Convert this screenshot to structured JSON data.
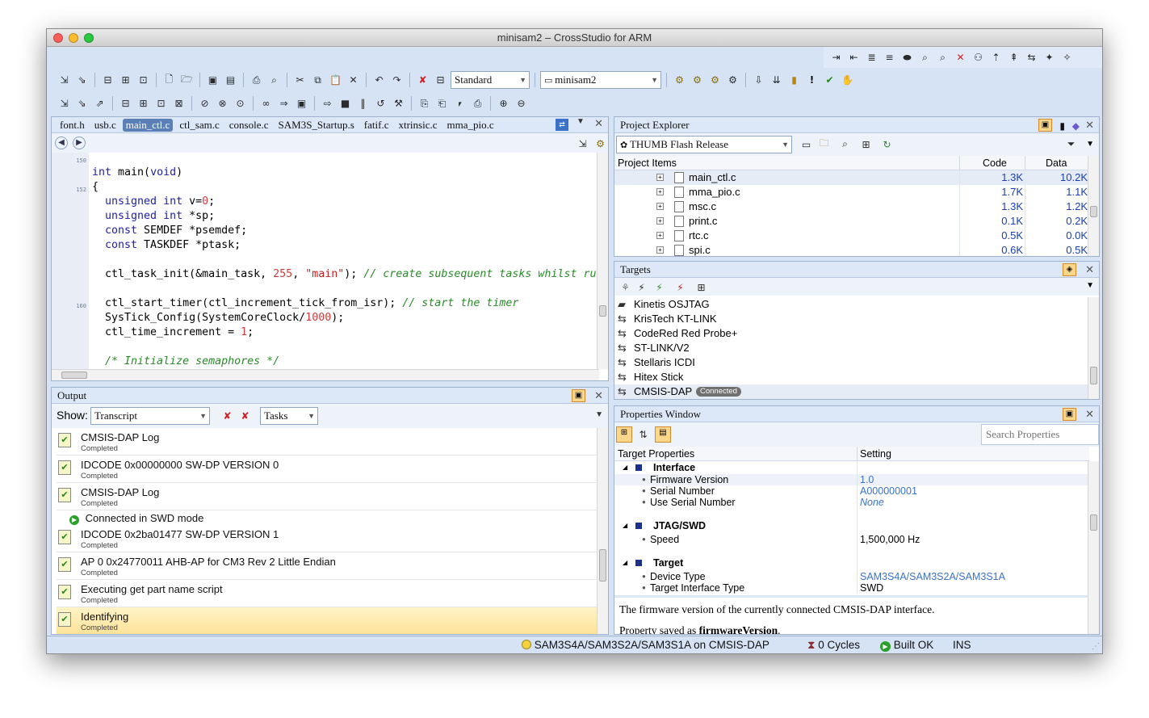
{
  "window": {
    "title": "minisam2 – CrossStudio for ARM"
  },
  "toolbar": {
    "build_config": "Standard",
    "project_combo": "minisam2"
  },
  "editor": {
    "tabs": [
      "font.h",
      "usb.c",
      "main_ctl.c",
      "ctl_sam.c",
      "console.c",
      "SAM3S_Startup.s",
      "fatif.c",
      "xtrinsic.c",
      "mma_pio.c"
    ],
    "line_numbers": [
      "150",
      "152",
      "160"
    ]
  },
  "output": {
    "title": "Output",
    "show_label": "Show:",
    "show_value": "Transcript",
    "tasks_value": "Tasks",
    "items": [
      {
        "text": "CMSIS-DAP Log",
        "status": "Completed"
      },
      {
        "text": "IDCODE 0x00000000 SW-DP VERSION 0",
        "status": "Completed"
      },
      {
        "text": "CMSIS-DAP Log",
        "status": "Completed"
      },
      {
        "text": "IDCODE 0x2ba01477 SW-DP VERSION 1",
        "status": "Completed"
      },
      {
        "text": "AP 0 0x24770011 AHB-AP for CM3 Rev 2 Little Endian",
        "status": "Completed"
      },
      {
        "text": "Executing get part name script",
        "status": "Completed"
      },
      {
        "text": "Identifying",
        "status": "Completed"
      }
    ],
    "connected_msg": "Connected in SWD mode"
  },
  "project_explorer": {
    "title": "Project Explorer",
    "config": "THUMB Flash Release",
    "columns": [
      "Project Items",
      "Code",
      "Data"
    ],
    "rows": [
      {
        "name": "main_ctl.c",
        "code": "1.3K",
        "data": "10.2K"
      },
      {
        "name": "mma_pio.c",
        "code": "1.7K",
        "data": "1.1K"
      },
      {
        "name": "msc.c",
        "code": "1.3K",
        "data": "1.2K"
      },
      {
        "name": "print.c",
        "code": "0.1K",
        "data": "0.2K"
      },
      {
        "name": "rtc.c",
        "code": "0.5K",
        "data": "0.0K"
      },
      {
        "name": "spi.c",
        "code": "0.6K",
        "data": "0.5K"
      }
    ]
  },
  "targets": {
    "title": "Targets",
    "items": [
      "Kinetis OSJTAG",
      "KrisTech KT-LINK",
      "CodeRed Red Probe+",
      "ST-LINK/V2",
      "Stellaris ICDI",
      "Hitex Stick",
      "CMSIS-DAP"
    ],
    "connected_badge": "Connected"
  },
  "properties": {
    "title": "Properties Window",
    "search_placeholder": "Search Properties",
    "columns": [
      "Target Properties",
      "Setting"
    ],
    "sections": [
      {
        "name": "Interface",
        "props": [
          {
            "name": "Firmware Version",
            "value": "1.0"
          },
          {
            "name": "Serial Number",
            "value": "A000000001"
          },
          {
            "name": "Use Serial Number",
            "value": "None"
          }
        ]
      },
      {
        "name": "JTAG/SWD",
        "props": [
          {
            "name": "Speed",
            "value": "1,500,000 Hz"
          }
        ]
      },
      {
        "name": "Target",
        "props": [
          {
            "name": "Device Type",
            "value": "SAM3S4A/SAM3S2A/SAM3S1A"
          },
          {
            "name": "Target Interface Type",
            "value": "SWD"
          }
        ]
      }
    ],
    "description": "The firmware version of the currently connected CMSIS-DAP interface.",
    "saved_prefix": "Property saved as ",
    "saved_name": "firmwareVersion",
    "saved_suffix": "."
  },
  "status": {
    "target": "SAM3S4A/SAM3S2A/SAM3S1A on CMSIS-DAP",
    "cycles": "0 Cycles",
    "build": "Built OK",
    "mode": "INS"
  }
}
